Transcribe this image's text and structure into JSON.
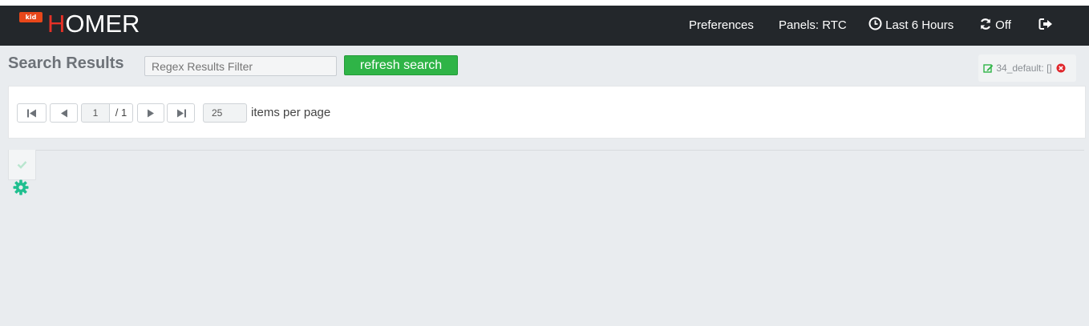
{
  "logo": {
    "badge": "kid"
  },
  "brand": {
    "first_letter": "H",
    "rest": "OMER"
  },
  "nav": {
    "preferences": "Preferences",
    "panels": "Panels: RTC",
    "time_range": "Last 6 Hours",
    "refresh": "Off"
  },
  "toolbar": {
    "title": "Search Results",
    "filter_placeholder": "Regex Results Filter",
    "refresh_label": "refresh search"
  },
  "tag": {
    "label": "34_default: []"
  },
  "pagination": {
    "current_page": "1",
    "total_pages": "/ 1",
    "per_page": "25",
    "per_page_label": "items per page"
  },
  "colors": {
    "navbar": "#23272b",
    "brand_accent": "#e53127",
    "refresh_button": "#2fb447",
    "gear": "#1fbf8f"
  }
}
